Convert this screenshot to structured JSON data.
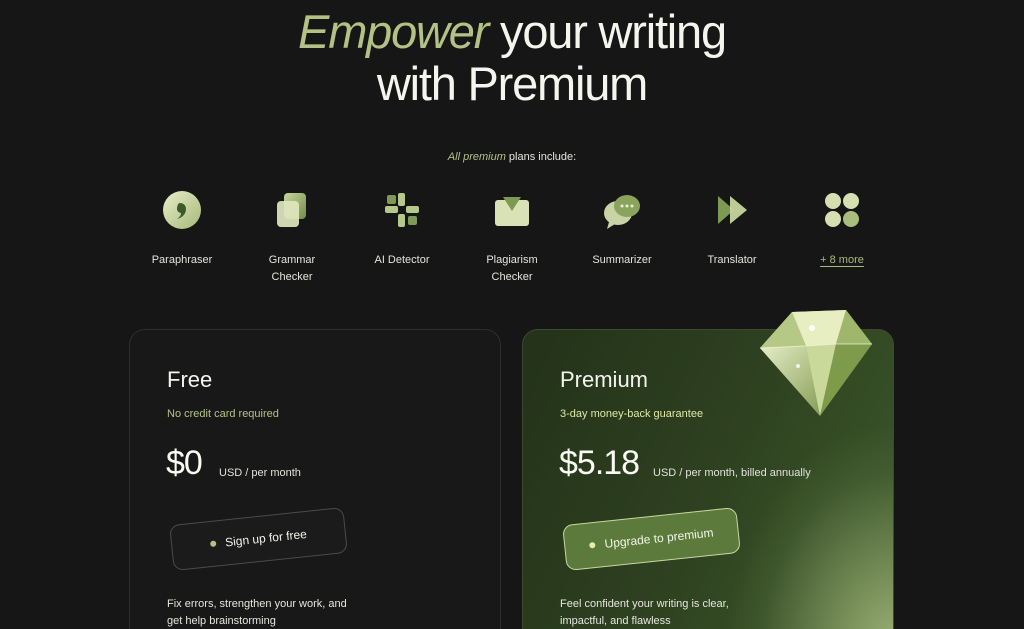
{
  "hero": {
    "accent": "Empower",
    "line1_rest": " your writing",
    "line2": "with Premium"
  },
  "includes": {
    "accent": "All premium",
    "rest": " plans include:"
  },
  "features": [
    {
      "label": "Paraphraser",
      "icon": "paraphraser-icon"
    },
    {
      "label": "Grammar Checker",
      "icon": "grammar-checker-icon"
    },
    {
      "label": "AI Detector",
      "icon": "ai-detector-icon"
    },
    {
      "label": "Plagiarism Checker",
      "icon": "plagiarism-checker-icon"
    },
    {
      "label": "Summarizer",
      "icon": "summarizer-icon"
    },
    {
      "label": "Translator",
      "icon": "translator-icon"
    },
    {
      "label": "+ 8 more",
      "icon": "more-grid-icon"
    }
  ],
  "plans": {
    "free": {
      "name": "Free",
      "sub": "No credit card required",
      "price": "$0",
      "period": "USD / per month",
      "cta": "Sign up for free",
      "desc": "Fix errors, strengthen your work, and get help brainstorming"
    },
    "premium": {
      "name": "Premium",
      "sub": "3-day money-back guarantee",
      "price": "$5.18",
      "period": "USD / per month, billed annually",
      "cta": "Upgrade to premium",
      "desc": "Feel confident your writing is clear, impactful, and flawless"
    }
  },
  "colors": {
    "background": "#161616",
    "accent": "#b4c186",
    "premium_card": "#2e4120",
    "premium_button": "#5c7a3c"
  }
}
